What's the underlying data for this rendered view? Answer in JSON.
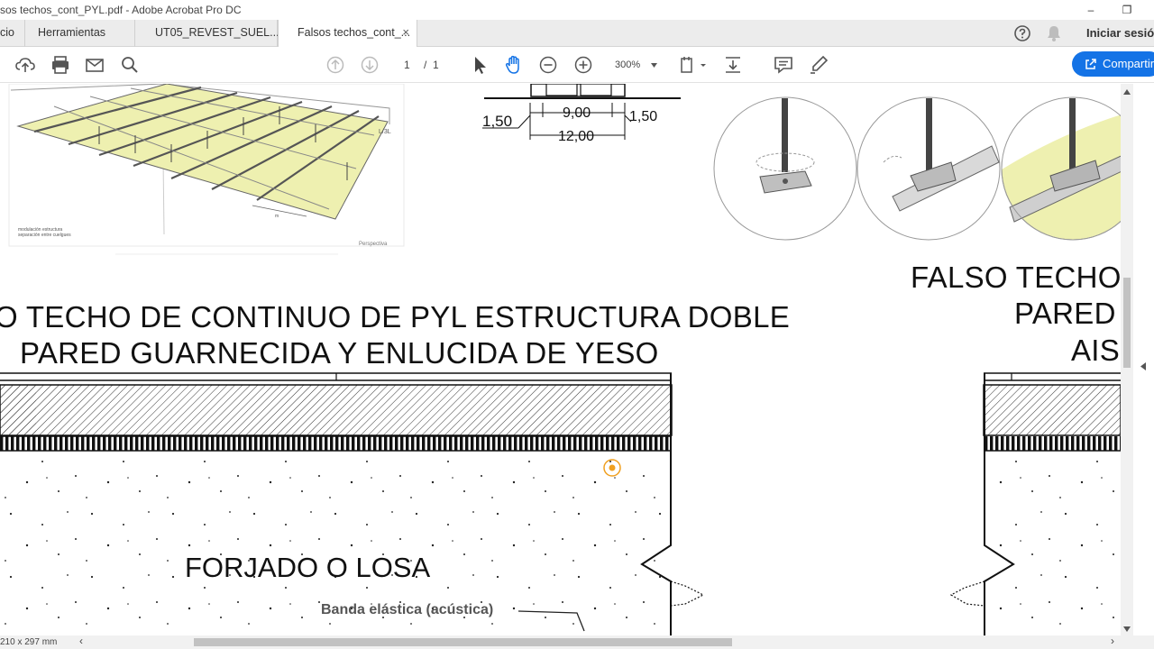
{
  "window": {
    "title": "sos techos_cont_PYL.pdf - Adobe Acrobat Pro DC",
    "minimize_glyph": "–",
    "restore_glyph": "❐"
  },
  "tabs": {
    "home": "cio",
    "tools": "Herramientas",
    "doc1": "UT05_REVEST_SUEL...",
    "doc2": "Falsos techos_cont_...",
    "close_glyph": "×",
    "signin": "Iniciar sesió"
  },
  "toolbar": {
    "page_current": "1",
    "page_sep": "/",
    "page_total": "1",
    "zoom": "300%",
    "share_label": "Compartir"
  },
  "drawing": {
    "title_left_line1": "O TECHO DE CONTINUO DE PYL ESTRUCTURA DOBLE",
    "title_left_line2": "PARED GUARNECIDA Y ENLUCIDA DE YESO",
    "title_right_line1": "FALSO TECHO D",
    "title_right_line2": "PARED C",
    "title_right_line3": "AISI",
    "label_forjado": "FORJADO O LOSA",
    "label_banda": "Banda elástica (acústica)",
    "dim_left": "1,50",
    "dim_mid": "9,00",
    "dim_right": "1,50",
    "dim_total": "12,00",
    "perspective_label": "Perspectiva",
    "legend_line1": "modulación estructura",
    "legend_line2": "separación entre cuelgues",
    "tag_label": "L/3L"
  },
  "status": {
    "page_size": "210 x 297 mm",
    "left_arrow": "‹",
    "right_arrow": "›"
  },
  "colors": {
    "accent": "#1473e6",
    "board": "#eef0b0",
    "cursor_ring": "#f0a020"
  }
}
